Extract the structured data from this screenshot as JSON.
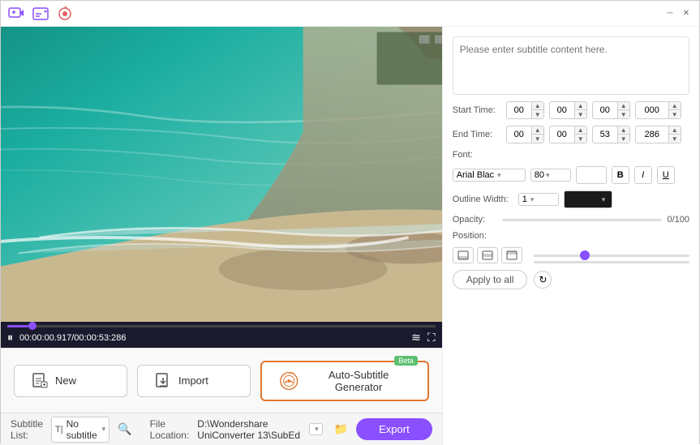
{
  "titleBar": {
    "icons": [
      "add-video-icon",
      "add-subtitle-icon",
      "record-icon"
    ],
    "controls": [
      "minimize",
      "close"
    ]
  },
  "video": {
    "currentTime": "00:00:00.917",
    "totalTime": "00:53:286",
    "timeDisplay": "00:00:00.917/00:00:53:286"
  },
  "actions": {
    "new": "New",
    "import": "Import",
    "autoSubtitle": "Auto-Subtitle Generator",
    "betaBadge": "Beta"
  },
  "rightPanel": {
    "subtitlePlaceholder": "Please enter subtitle content here.",
    "startTimeLabel": "Start Time:",
    "endTimeLabel": "End Time:",
    "startTime": {
      "h": "00",
      "m": "00",
      "s": "00",
      "ms": "000"
    },
    "endTime": {
      "h": "00",
      "m": "00",
      "s": "53",
      "ms": "286"
    },
    "fontLabel": "Font:",
    "fontFamily": "Arial Blac",
    "fontSize": "80",
    "outlineWidthLabel": "Outline Width:",
    "outlineWidth": "1",
    "opacityLabel": "Opacity:",
    "opacityValue": "0/100",
    "positionLabel": "Position:",
    "applyToAll": "Apply to all",
    "boldLabel": "B",
    "italicLabel": "I",
    "underlineLabel": "U"
  },
  "statusBar": {
    "subtitleListLabel": "Subtitle List:",
    "subtitleListIcon": "T|",
    "subtitleListValue": "No subtitle",
    "searchIcon": "search",
    "fileLocationLabel": "File Location:",
    "fileLocationPath": "D:\\Wondershare UniConverter 13\\SubEd",
    "folderIcon": "folder",
    "exportLabel": "Export"
  }
}
